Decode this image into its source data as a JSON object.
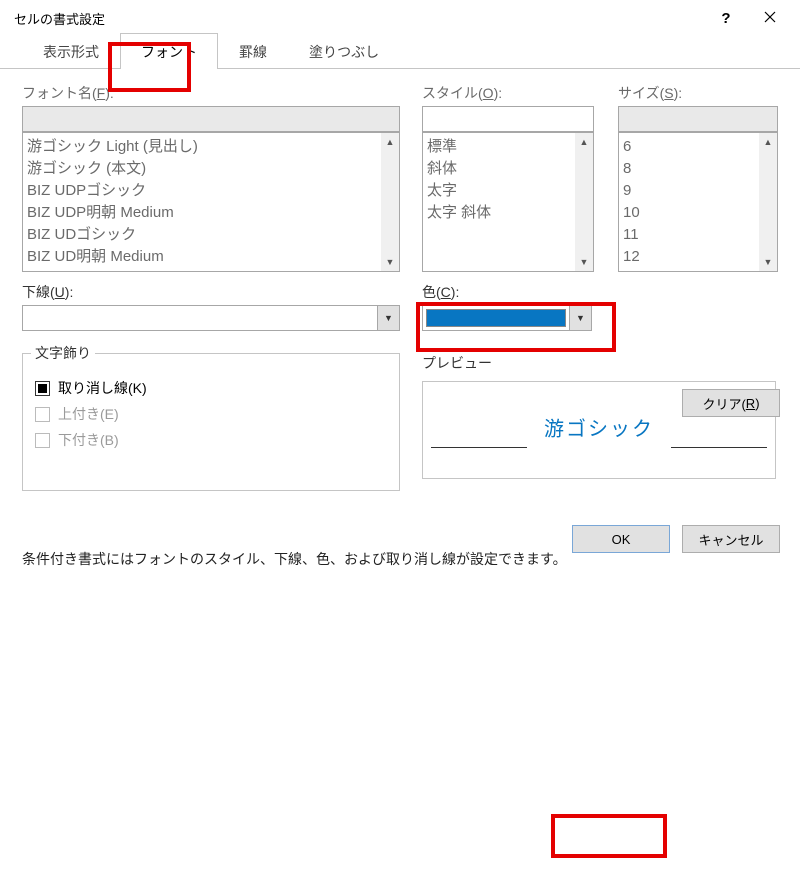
{
  "titlebar": {
    "title": "セルの書式設定"
  },
  "tabs": {
    "items": [
      {
        "label": "表示形式"
      },
      {
        "label": "フォント"
      },
      {
        "label": "罫線"
      },
      {
        "label": "塗りつぶし"
      }
    ],
    "active_index": 1
  },
  "font_section": {
    "label_prefix": "フォント名(",
    "label_key": "F",
    "label_suffix": "):",
    "items": [
      "游ゴシック Light (見出し)",
      "游ゴシック (本文)",
      "BIZ UDPゴシック",
      "BIZ UDP明朝 Medium",
      "BIZ UDゴシック",
      "BIZ UD明朝 Medium"
    ]
  },
  "style_section": {
    "label_prefix": "スタイル(",
    "label_key": "O",
    "label_suffix": "):",
    "items": [
      "標準",
      "斜体",
      "太字",
      "太字 斜体"
    ]
  },
  "size_section": {
    "label_prefix": "サイズ(",
    "label_key": "S",
    "label_suffix": "):",
    "items": [
      "6",
      "8",
      "9",
      "10",
      "11",
      "12"
    ]
  },
  "underline": {
    "label_prefix": "下線(",
    "label_key": "U",
    "label_suffix": "):"
  },
  "color": {
    "label_prefix": "色(",
    "label_key": "C",
    "label_suffix": "):",
    "swatch": "#0876c2"
  },
  "effects": {
    "legend": "文字飾り",
    "strike_prefix": "取り消し線(",
    "strike_key": "K",
    "strike_suffix": ")",
    "super_label": "上付き(E)",
    "sub_label": "下付き(B)"
  },
  "preview": {
    "legend": "プレビュー",
    "text": "游ゴシック"
  },
  "info_text": "条件付き書式にはフォントのスタイル、下線、色、および取り消し線が設定できます。",
  "buttons": {
    "clear_prefix": "クリア(",
    "clear_key": "R",
    "clear_suffix": ")",
    "ok": "OK",
    "cancel": "キャンセル"
  }
}
